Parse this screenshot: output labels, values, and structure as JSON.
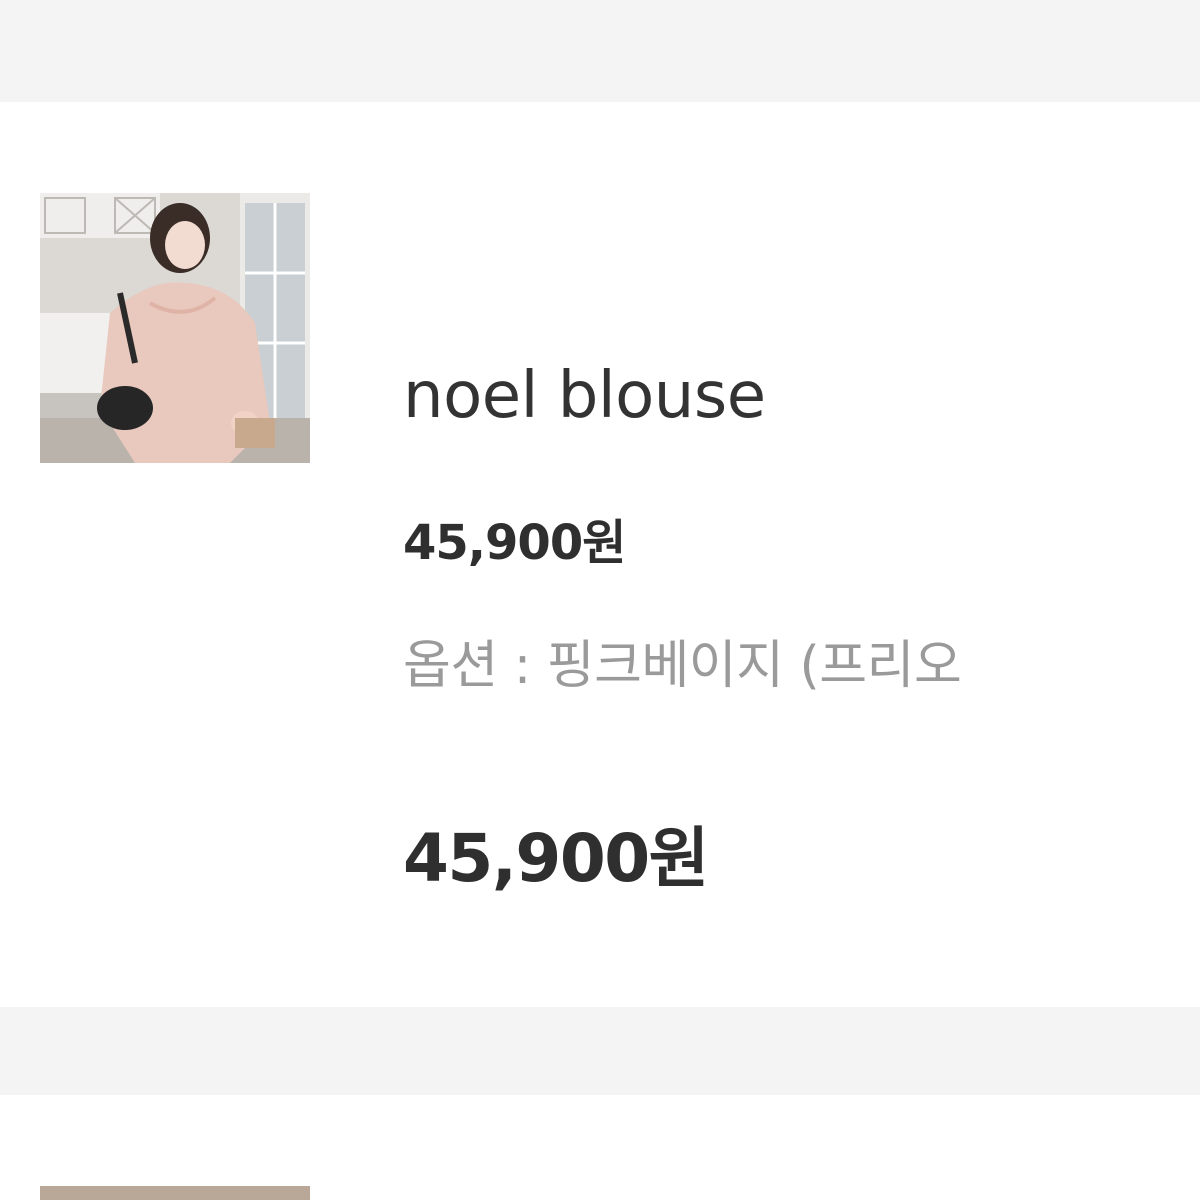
{
  "order_item": {
    "name": "noel blouse",
    "unit_price": "45,900원",
    "option": "옵션 : 핑크베이지 (프리오",
    "total_price": "45,900원",
    "thumbnail_alt": "product-photo"
  },
  "colors": {
    "band": "#f4f4f4",
    "text_primary": "#2f2f2f",
    "text_secondary": "#9a9a9a"
  }
}
